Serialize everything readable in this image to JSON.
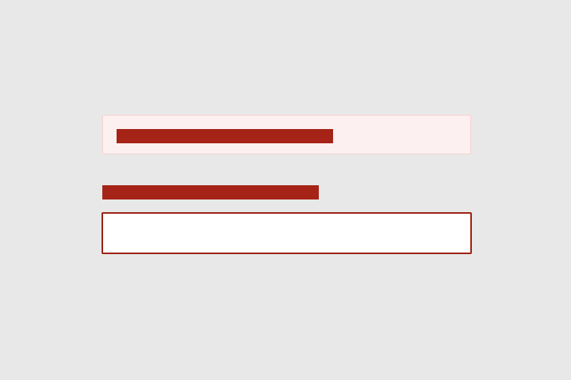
{
  "theme": {
    "page_background": "#e8e8e8",
    "error_color": "#a52417",
    "error_banner_background": "#fcf0f0",
    "error_banner_border": "#f9d2d2",
    "input_error_border": "#9c2215"
  },
  "error_banner": {
    "message": ""
  },
  "field": {
    "label": "",
    "value": "",
    "placeholder": "",
    "state": "error"
  }
}
